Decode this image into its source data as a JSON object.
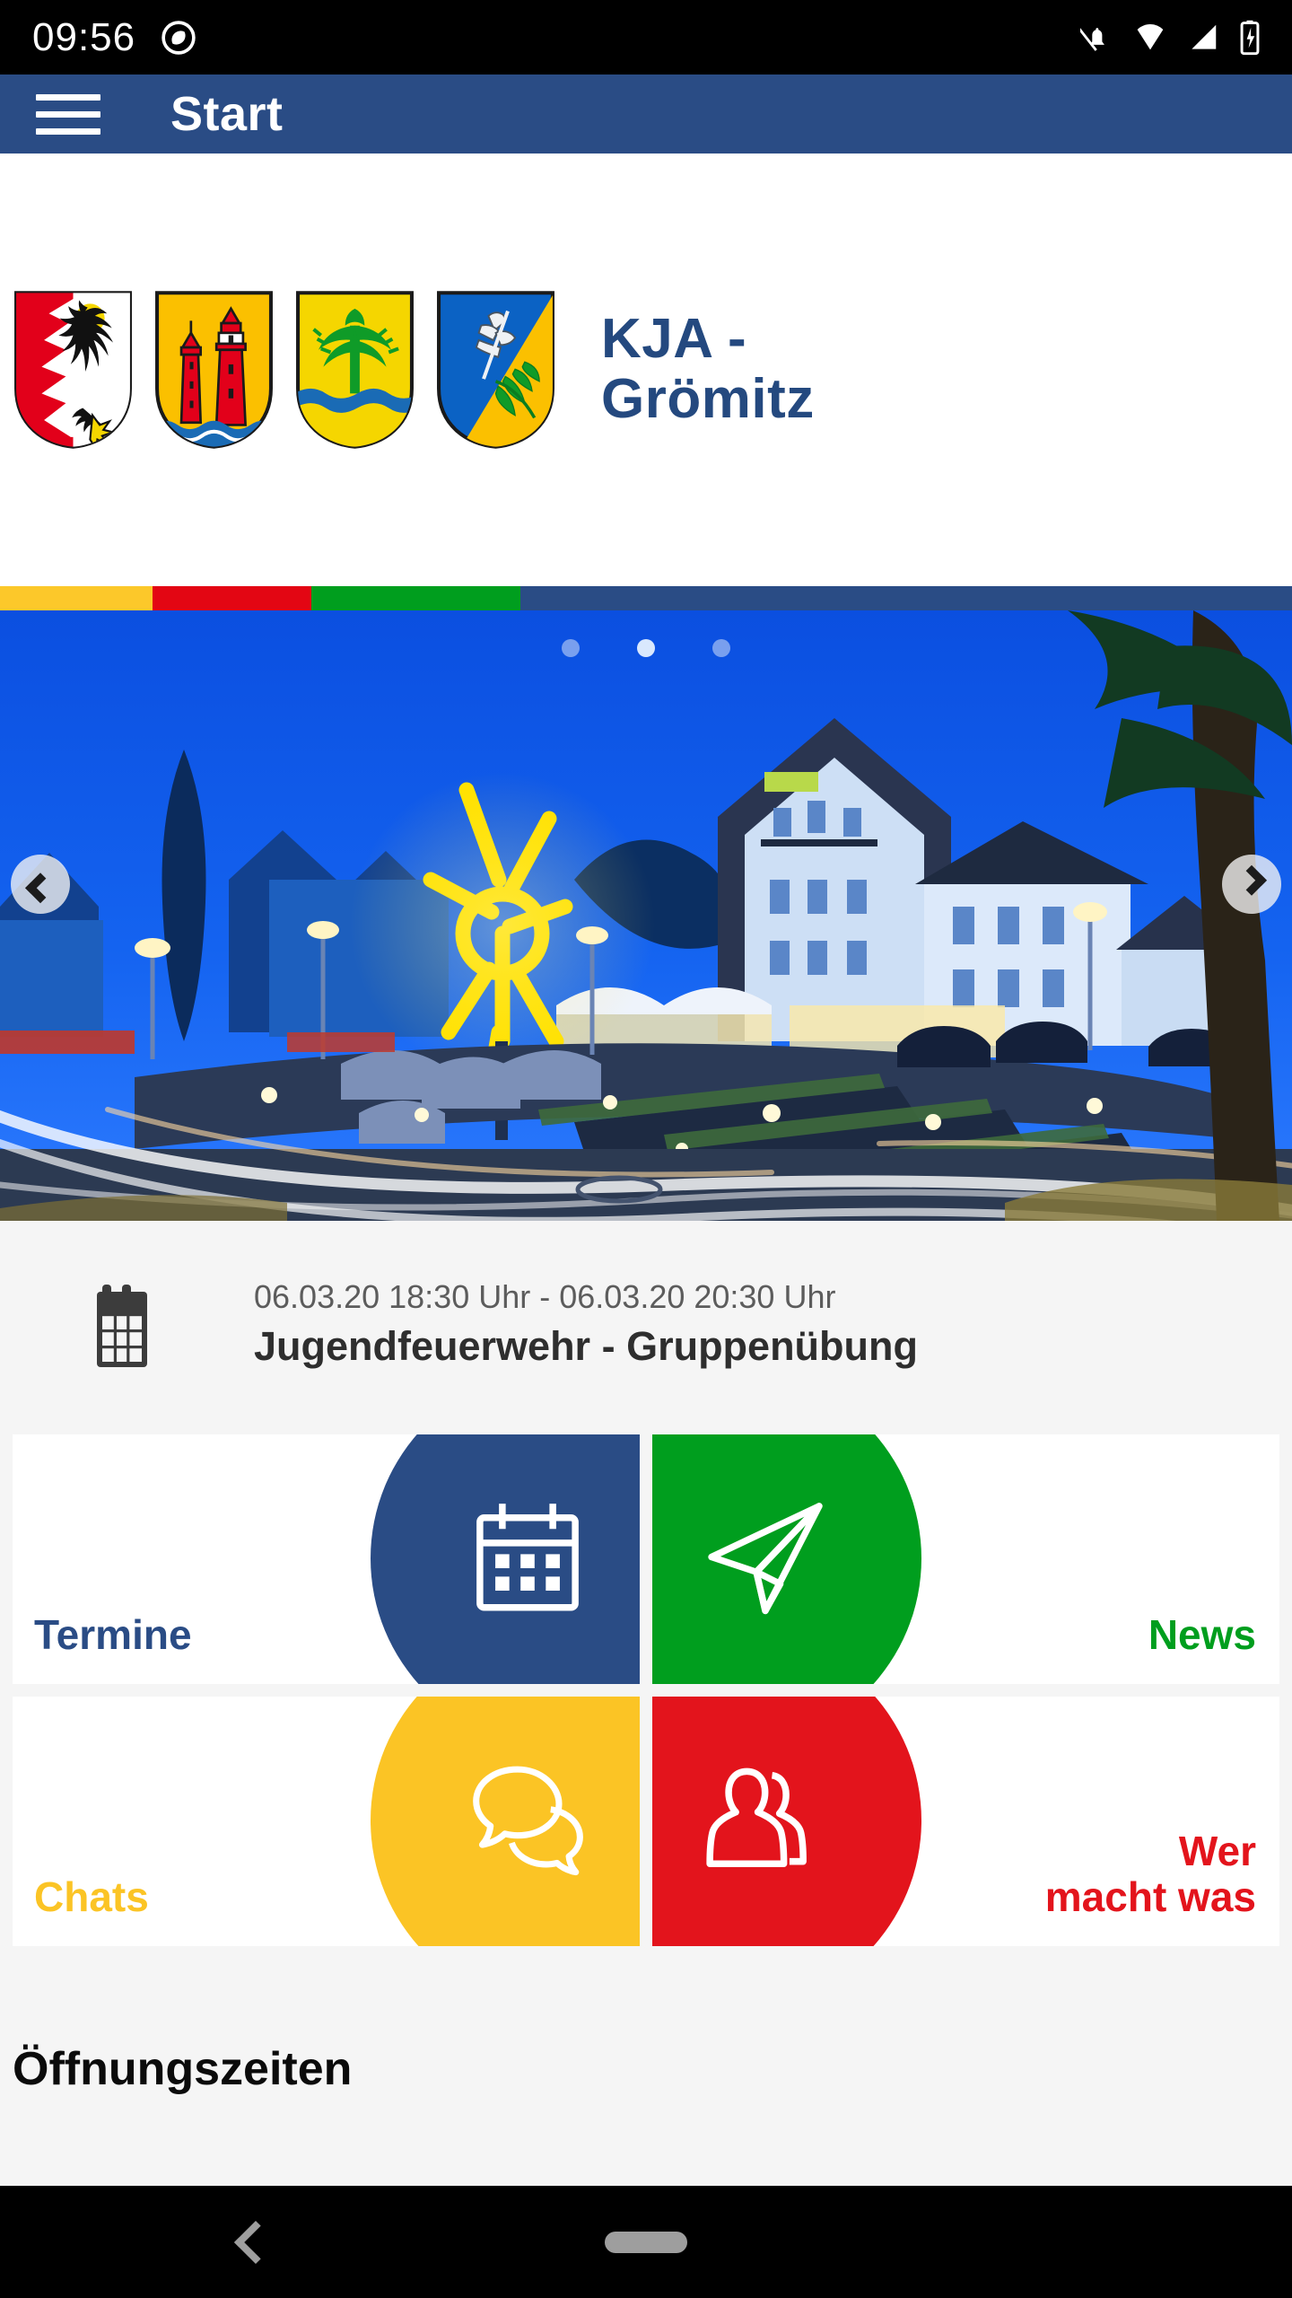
{
  "statusbar": {
    "time": "09:56",
    "icons": [
      "app-circle-icon",
      "notifications-off-icon",
      "wifi-icon",
      "signal-icon",
      "battery-charging-icon"
    ]
  },
  "appbar": {
    "menu_icon": "hamburger-menu-icon",
    "title": "Start",
    "background": "#2a4c85"
  },
  "logo_band": {
    "brand_text": "KJA -\nGrömitz",
    "brand_color": "#24497f",
    "crests": [
      {
        "name": "schleswig-holstein-coat-of-arms",
        "colors": [
          "#e2001a",
          "#ffffff",
          "#000000",
          "#f5d600"
        ]
      },
      {
        "name": "grömitz-lighthouse-coat-of-arms",
        "colors": [
          "#fbc000",
          "#e2001a",
          "#1a6bb5",
          "#ffffff"
        ]
      },
      {
        "name": "tree-water-coat-of-arms",
        "colors": [
          "#f5d600",
          "#0f9b28",
          "#1a6bb5"
        ]
      },
      {
        "name": "fisherman-oak-coat-of-arms",
        "colors": [
          "#0b62c4",
          "#fbc000",
          "#0f9b28",
          "#ffffff"
        ]
      }
    ]
  },
  "color_strip": [
    {
      "name": "strip-yellow",
      "color": "#fcc82a",
      "width_pct": 11.8
    },
    {
      "name": "strip-red",
      "color": "#e30613",
      "width_pct": 12.3
    },
    {
      "name": "strip-green",
      "color": "#009e1e",
      "width_pct": 16.2
    },
    {
      "name": "strip-blue",
      "color": "#2a4c85",
      "width_pct": 59.7
    }
  ],
  "hero": {
    "alt": "Grömitz town roundabout at blue hour with illuminated sun sculpture",
    "prev_label": "‹",
    "next_label": "›",
    "dots": [
      {
        "name": "carousel-dot-1",
        "active": false
      },
      {
        "name": "carousel-dot-2",
        "active": true
      },
      {
        "name": "carousel-dot-3",
        "active": false
      }
    ]
  },
  "event": {
    "icon": "calendar-icon",
    "time": "06.03.20 18:30 Uhr - 06.03.20 20:30 Uhr",
    "title": "Jugendfeuerwehr - Gruppenübung"
  },
  "tiles": [
    {
      "name": "tile-termine",
      "label": "Termine",
      "color": "#2a4c85",
      "icon": "calendar-icon",
      "side": "left"
    },
    {
      "name": "tile-news",
      "label": "News",
      "color": "#009e1e",
      "icon": "paper-plane-icon",
      "side": "right"
    },
    {
      "name": "tile-chats",
      "label": "Chats",
      "color": "#fbc425",
      "icon": "speech-bubbles-icon",
      "side": "left"
    },
    {
      "name": "tile-wer-macht-was",
      "label": "Wer\nmacht was",
      "color": "#e3141c",
      "icon": "people-icon",
      "side": "right"
    }
  ],
  "section": {
    "opening_hours_heading": "Öffnungszeiten"
  },
  "navbar": {
    "back_icon": "back-chevron-icon",
    "home_icon": "home-pill-icon"
  }
}
